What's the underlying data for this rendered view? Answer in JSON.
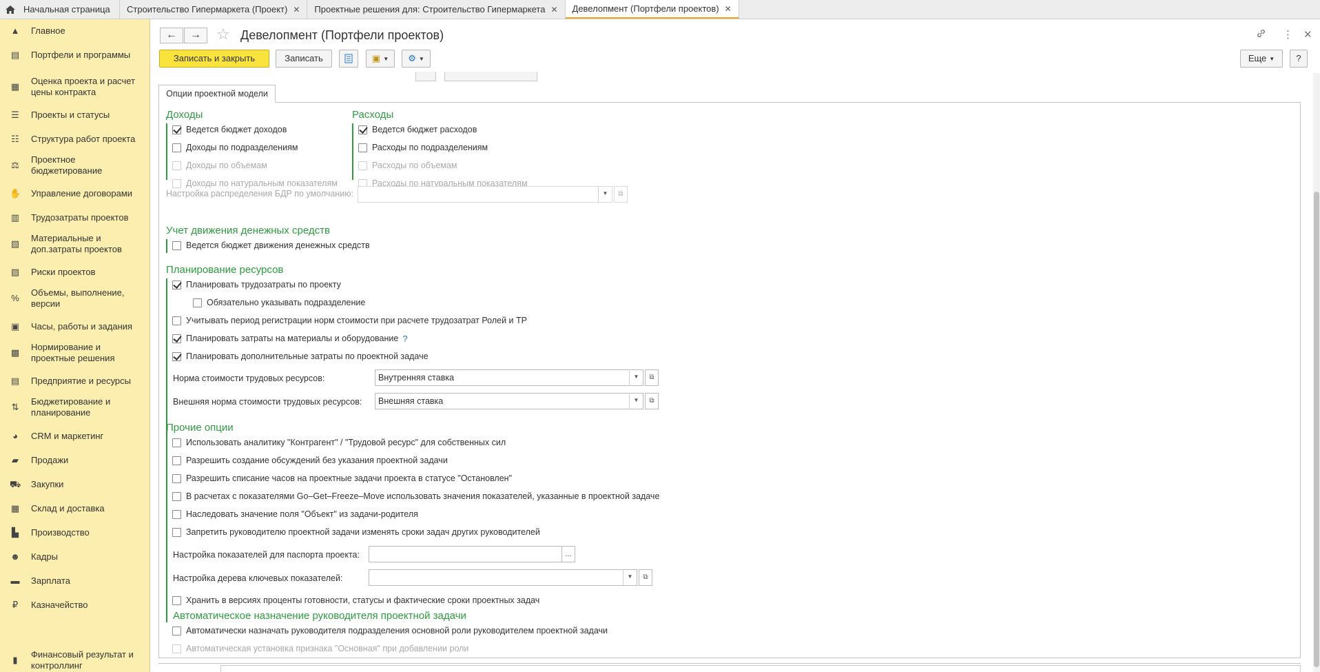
{
  "tabs": [
    {
      "label": "Начальная страница",
      "home": true
    },
    {
      "label": "Строительство Гипермаркета (Проект)",
      "close": "✕"
    },
    {
      "label": "Проектные решения для: Строительство Гипермаркета",
      "close": "✕"
    },
    {
      "label": "Девелопмент (Портфели проектов)",
      "close": "✕",
      "active": true
    }
  ],
  "sidebar": {
    "items": [
      {
        "label": "Главное",
        "icon": "main-icon"
      },
      {
        "label": "Портфели и программы",
        "icon": "portfolio-icon"
      },
      {
        "label": "Оценка проекта и расчет цены контракта",
        "icon": "estimate-icon"
      },
      {
        "label": "Проекты и статусы",
        "icon": "projects-icon"
      },
      {
        "label": "Структура работ проекта",
        "icon": "wbs-icon"
      },
      {
        "label": "Проектное бюджетирование",
        "icon": "budget-icon"
      },
      {
        "label": "Управление договорами",
        "icon": "contracts-icon"
      },
      {
        "label": "Трудозатраты проектов",
        "icon": "labor-icon"
      },
      {
        "label": "Материальные и доп.затраты проектов",
        "icon": "materials-icon"
      },
      {
        "label": "Риски проектов",
        "icon": "risks-icon"
      },
      {
        "label": "Объемы, выполнение, версии",
        "icon": "volumes-icon"
      },
      {
        "label": "Часы, работы и задания",
        "icon": "hours-icon"
      },
      {
        "label": "Нормирование и проектные решения",
        "icon": "norms-icon"
      },
      {
        "label": "Предприятие и ресурсы",
        "icon": "enterprise-icon"
      },
      {
        "label": "Бюджетирование и планирование",
        "icon": "planning-icon"
      },
      {
        "label": "CRM и маркетинг",
        "icon": "crm-icon"
      },
      {
        "label": "Продажи",
        "icon": "sales-icon"
      },
      {
        "label": "Закупки",
        "icon": "purchases-icon"
      },
      {
        "label": "Склад и доставка",
        "icon": "warehouse-icon"
      },
      {
        "label": "Производство",
        "icon": "production-icon"
      },
      {
        "label": "Кадры",
        "icon": "hr-icon"
      },
      {
        "label": "Зарплата",
        "icon": "salary-icon"
      },
      {
        "label": "Казначейство",
        "icon": "treasury-icon"
      },
      {
        "label": "Финансовый результат и контроллинг",
        "icon": "finance-icon"
      }
    ]
  },
  "window": {
    "title": "Девелопмент (Портфели проектов)",
    "back": "←",
    "forward": "→",
    "star": "☆",
    "link_icon": "🔗",
    "more_icon": "⋮",
    "close_icon": "✕"
  },
  "toolbar": {
    "save_close": "Записать и закрыть",
    "save": "Записать",
    "more": "Еще",
    "help": "?"
  },
  "options_tab": "Опции проектной модели",
  "income": {
    "title": "Доходы",
    "items": [
      {
        "label": "Ведется бюджет доходов",
        "checked": true,
        "disabled": false
      },
      {
        "label": "Доходы по подразделениям",
        "checked": false,
        "disabled": false
      },
      {
        "label": "Доходы по объемам",
        "checked": false,
        "disabled": true
      },
      {
        "label": "Доходы по натуральным показателям",
        "checked": false,
        "disabled": true
      }
    ]
  },
  "expenses": {
    "title": "Расходы",
    "items": [
      {
        "label": "Ведется бюджет расходов",
        "checked": true,
        "disabled": false
      },
      {
        "label": "Расходы по подразделениям",
        "checked": false,
        "disabled": false
      },
      {
        "label": "Расходы по объемам",
        "checked": false,
        "disabled": true
      },
      {
        "label": "Расходы по натуральным показателям",
        "checked": false,
        "disabled": true
      }
    ]
  },
  "bdr_setting": {
    "label": "Настройка распределения БДР по умолчанию:",
    "value": ""
  },
  "cashflow": {
    "title": "Учет движения денежных средств",
    "items": [
      {
        "label": "Ведется бюджет движения денежных средств",
        "checked": false
      }
    ]
  },
  "resources": {
    "title": "Планирование ресурсов",
    "items": [
      {
        "label": "Планировать трудозатраты по проекту",
        "checked": true
      },
      {
        "label": "Обязательно указывать подразделение",
        "checked": false
      },
      {
        "label": "Учитывать период регистрации норм стоимости при расчете трудозатрат Ролей и ТР",
        "checked": false
      },
      {
        "label": "Планировать затраты на материалы и оборудование",
        "checked": true,
        "help": "?"
      },
      {
        "label": "Планировать дополнительные затраты по проектной задаче",
        "checked": true
      }
    ],
    "labor_rate": {
      "label": "Норма стоимости трудовых ресурсов:",
      "value": "Внутренняя ставка"
    },
    "ext_labor_rate": {
      "label": "Внешняя норма стоимости трудовых ресурсов:",
      "value": "Внешняя ставка"
    }
  },
  "other": {
    "title": "Прочие опции",
    "items": [
      {
        "label": "Использовать аналитику \"Контрагент\" / \"Трудовой ресурс\" для собственных сил",
        "checked": false
      },
      {
        "label": "Разрешить создание обсуждений без указания проектной задачи",
        "checked": false
      },
      {
        "label": "Разрешить списание часов на проектные задачи проекта в статусе \"Остановлен\"",
        "checked": false
      },
      {
        "label": "В расчетах с показателями Go–Get–Freeze–Move использовать значения показателей, указанные в проектной задаче",
        "checked": false
      },
      {
        "label": "Наследовать значение поля \"Объект\" из задачи-родителя",
        "checked": false
      },
      {
        "label": "Запретить руководителю проектной задачи изменять сроки задач других руководителей",
        "checked": false
      }
    ],
    "passport": {
      "label": "Настройка показателей для паспорта проекта:",
      "value": "",
      "btn": "..."
    },
    "kpi_tree": {
      "label": "Настройка дерева ключевых показателей:",
      "value": ""
    },
    "keep_versions": {
      "label": "Хранить в версиях проценты готовности, статусы и фактические сроки проектных задач",
      "checked": false
    }
  },
  "auto_assign": {
    "title": "Автоматическое назначение руководителя проектной задачи",
    "items": [
      {
        "label": "Автоматически назначать руководителя подразделения основной роли руководителем проектной задачи",
        "checked": false,
        "disabled": false
      },
      {
        "label": "Автоматическая установка признака \"Основная\" при добавлении роли",
        "checked": false,
        "disabled": true
      }
    ]
  },
  "colors": {
    "accent_green": "#2d9c3f",
    "sidebar_bg": "#fbeeaf",
    "primary_button": "#fbe33d",
    "active_tab_marker": "#f5a31a"
  }
}
